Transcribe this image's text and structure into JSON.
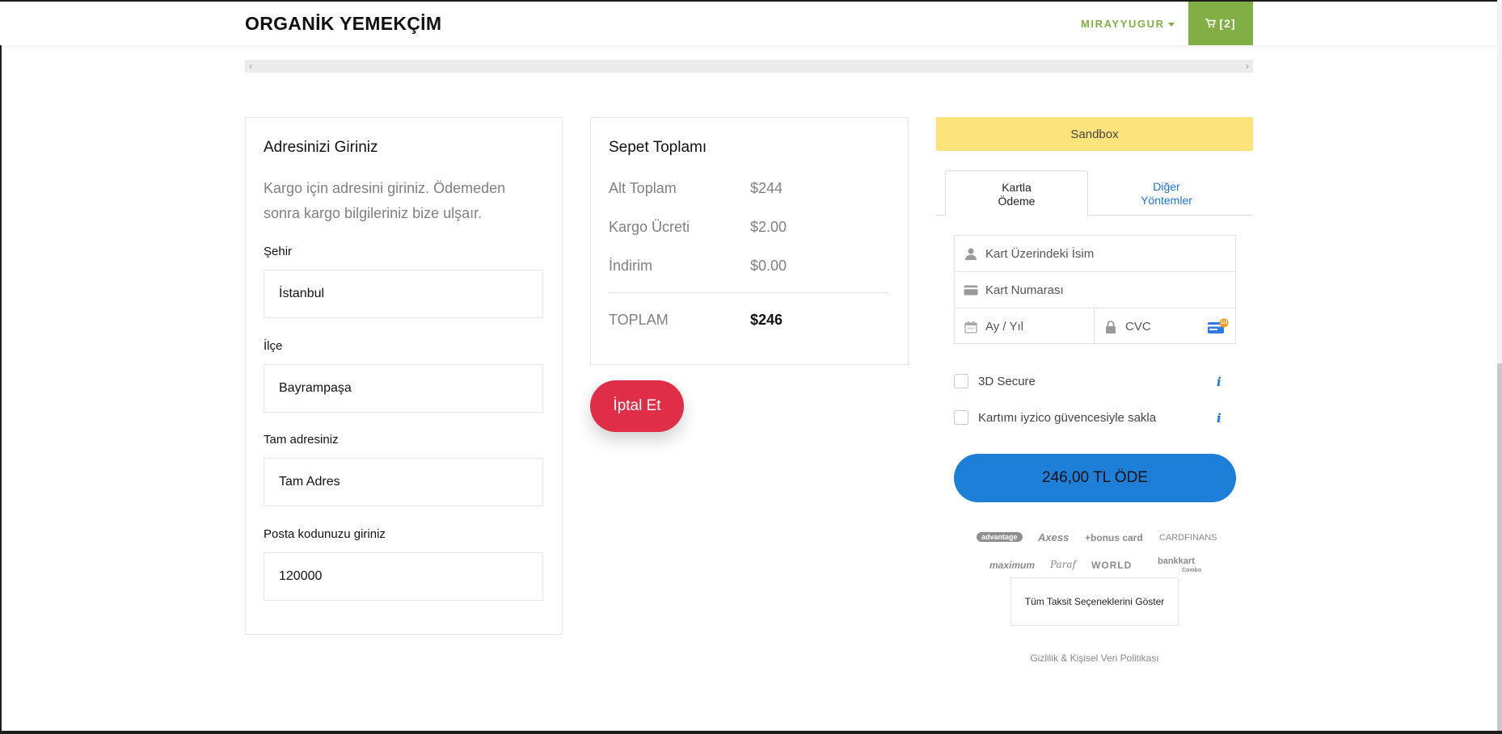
{
  "header": {
    "brand": "ORGANİK YEMEKÇİM",
    "user_menu": "MIRAYYUGUR",
    "cart_label": "[2]"
  },
  "scrollbar": {
    "left_arrow": "‹",
    "right_arrow": "›"
  },
  "address": {
    "title": "Adresinizi Giriniz",
    "description": "Kargo için adresini giriniz. Ödemeden sonra kargo bilgileriniz bize ulşaır.",
    "fields": [
      {
        "label": "Şehir",
        "value": "İstanbul"
      },
      {
        "label": "İlçe",
        "value": "Bayrampaşa"
      },
      {
        "label": "Tam adresiniz",
        "value": "Tam Adres"
      },
      {
        "label": "Posta kodunuzu giriniz",
        "value": "120000"
      }
    ]
  },
  "totals": {
    "title": "Sepet Toplamı",
    "rows": [
      {
        "label": "Alt Toplam",
        "value": "$244"
      },
      {
        "label": "Kargo Ücreti",
        "value": "$2.00"
      },
      {
        "label": "İndirim",
        "value": "$0.00"
      }
    ],
    "total_label": "TOPLAM",
    "total_value": "$246",
    "cancel_button": "İptal Et"
  },
  "payment": {
    "sandbox_label": "Sandbox",
    "tabs": [
      {
        "line1": "Kartla",
        "line2": "Ödeme"
      },
      {
        "line1": "Diğer",
        "line2": "Yöntemler"
      }
    ],
    "name_placeholder": "Kart Üzerindeki İsim",
    "number_placeholder": "Kart Numarası",
    "expiry_placeholder": "Ay / Yıl",
    "cvc_placeholder": "CVC",
    "cvc_badge": "123",
    "secure_label": "3D Secure",
    "save_card_label": "Kartımı iyzico güvencesiyle sakla",
    "info_symbol": "i",
    "pay_button": "246,00 TL ÖDE",
    "card_logos": [
      "advantage",
      "Axess",
      "+bonus card",
      "CARDFINANS",
      "maximum",
      "Paraf",
      "WORLD",
      "bankkart"
    ],
    "bankkart_sub": "Combo",
    "installments_button": "Tüm Taksit Seçeneklerini Göster",
    "privacy_link": "Gizlilik & Kişisel Veri Politikası"
  },
  "colors": {
    "accent_green": "#82ae46",
    "cancel_red": "#e02d48",
    "pay_blue": "#1e7fd9",
    "sandbox_yellow": "#fce37a",
    "link_blue": "#1b74d8"
  }
}
